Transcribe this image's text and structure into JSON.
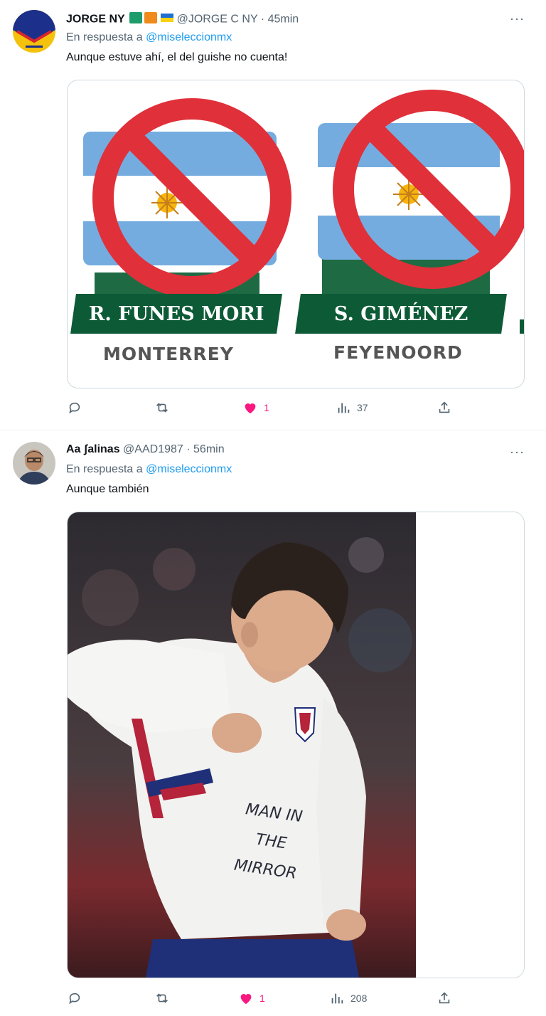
{
  "tweets": [
    {
      "display_name": "JORGE NY",
      "handle": "@JORGE C NY",
      "time": "45min",
      "reply_prefix": "En respuesta a",
      "reply_to": "@miseleccionmx",
      "text": "Aunque estuve ahí, el del guishe no cuenta!",
      "media": {
        "players": [
          {
            "name": "R. FUNES MORI",
            "club": "MONTERREY"
          },
          {
            "name": "S. GIMÉNEZ",
            "club": "FEYENOORD"
          }
        ]
      },
      "stats": {
        "likes": "1",
        "views": "37"
      }
    },
    {
      "display_name": "Aa ʃalinas",
      "handle": "@AAD1987",
      "time": "56min",
      "reply_prefix": "En respuesta a",
      "reply_to": "@miseleccionmx",
      "text": "Aunque también",
      "media": {
        "shirt_text": [
          "MAN IN",
          "THE",
          "MIRROR"
        ]
      },
      "stats": {
        "likes": "1",
        "views": "208"
      }
    }
  ],
  "icons": {
    "more": "more-dots-icon",
    "reply": "reply-icon",
    "retweet": "retweet-icon",
    "like": "heart-icon",
    "views": "views-icon",
    "share": "share-icon"
  },
  "colors": {
    "like": "#f91880",
    "link": "#1d9bf0",
    "plate": "#0d5a36",
    "ban": "#e0303a"
  }
}
